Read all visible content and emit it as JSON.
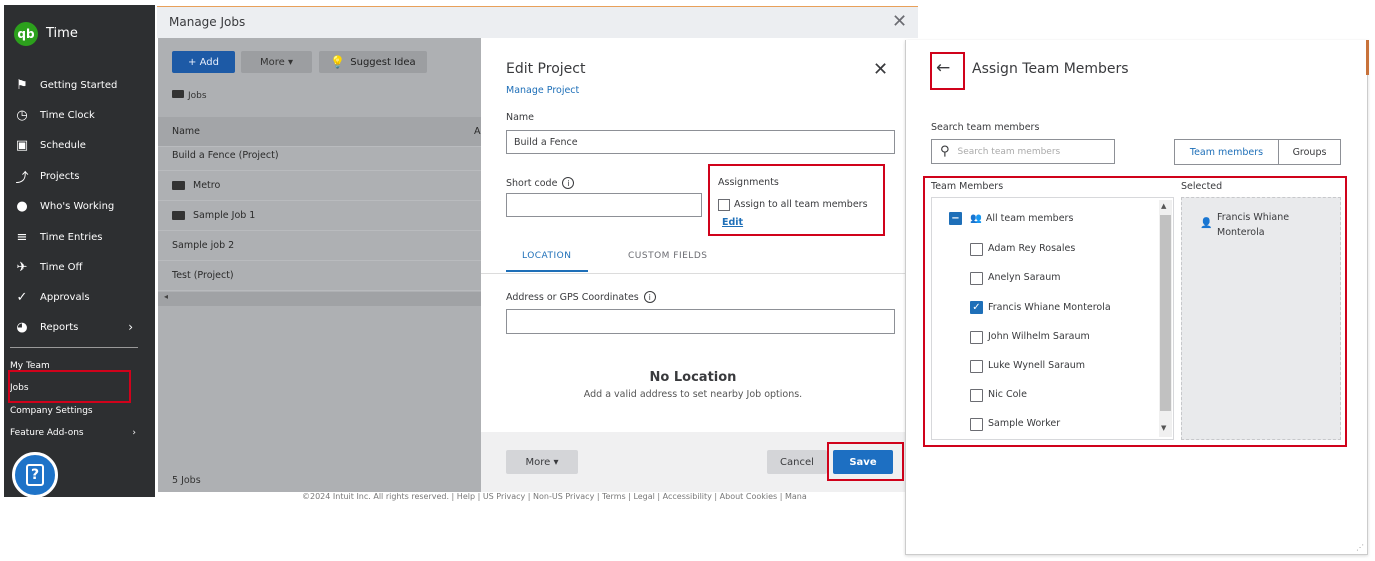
{
  "sidebar": {
    "logo_text": "qb",
    "app_name": "Time",
    "items": [
      {
        "icon": "flag-icon",
        "glyph": "⚑",
        "label": "Getting Started"
      },
      {
        "icon": "clock-icon",
        "glyph": "◷",
        "label": "Time Clock"
      },
      {
        "icon": "calendar-icon",
        "glyph": "▣",
        "label": "Schedule"
      },
      {
        "icon": "projects-icon",
        "glyph": "⤴",
        "label": "Projects"
      },
      {
        "icon": "location-pin-icon",
        "glyph": "●",
        "label": "Who's Working"
      },
      {
        "icon": "time-entries-icon",
        "glyph": "≡",
        "label": "Time Entries"
      },
      {
        "icon": "plane-icon",
        "glyph": "✈",
        "label": "Time Off"
      },
      {
        "icon": "approvals-icon",
        "glyph": "✓",
        "label": "Approvals"
      },
      {
        "icon": "pie-chart-icon",
        "glyph": "◕",
        "label": "Reports",
        "chevron": "›"
      }
    ],
    "secondary": [
      {
        "label": "My Team"
      },
      {
        "label": "Jobs"
      },
      {
        "label": "Company Settings"
      },
      {
        "label": "Feature Add-ons",
        "chevron": "›"
      }
    ],
    "help_glyph": "?"
  },
  "manage_jobs": {
    "title": "Manage Jobs",
    "close": "✕",
    "add_label": "+ Add",
    "more_label": "More  ▾",
    "suggest_label": "Suggest Idea",
    "breadcrumb": "Jobs",
    "column_name": "Name",
    "column_second": "A",
    "rows": [
      "Build a Fence (Project)",
      "Metro",
      "Sample Job 1",
      "Sample job 2",
      "Test (Project)"
    ],
    "scroll_left": "◂",
    "footer_count": "5 Jobs",
    "copyright": "©2024 Intuit Inc. All rights reserved.  |  Help  |  US Privacy  |  Non-US Privacy  |  Terms  |  Legal  |  Accessibility  |  About Cookies  |  Mana"
  },
  "edit_project": {
    "title": "Edit Project",
    "close": "✕",
    "manage_link": "Manage Project",
    "name_label": "Name",
    "name_value": "Build a Fence",
    "short_code_label": "Short code",
    "assignments_label": "Assignments",
    "assign_all_label": "Assign to all team members",
    "edit_link": "Edit",
    "tab_location": "LOCATION",
    "tab_custom": "CUSTOM FIELDS",
    "address_label": "Address or GPS Coordinates",
    "no_location": "No Location",
    "no_location_sub": "Add a valid address to set nearby Job options.",
    "more_label": "More  ▾",
    "cancel_label": "Cancel",
    "save_label": "Save",
    "info_glyph": "i"
  },
  "assign_panel": {
    "back": "←",
    "title": "Assign Team Members",
    "search_label": "Search team members",
    "search_placeholder": "Search team members",
    "seg_team": "Team members",
    "seg_groups": "Groups",
    "team_members_label": "Team Members",
    "selected_label": "Selected",
    "all_label": "All team members",
    "members": [
      {
        "name": "Adam Rey Rosales",
        "checked": false
      },
      {
        "name": "Anelyn Saraum",
        "checked": false
      },
      {
        "name": "Francis Whiane Monterola",
        "checked": true
      },
      {
        "name": "John Wilhelm Saraum",
        "checked": false
      },
      {
        "name": "Luke Wynell Saraum",
        "checked": false
      },
      {
        "name": "Nic Cole",
        "checked": false
      },
      {
        "name": "Sample Worker",
        "checked": false
      }
    ],
    "selected": [
      "Francis Whiane",
      "Monterola"
    ],
    "accent": "#1e6fb8",
    "highlight": "#d0021b"
  }
}
